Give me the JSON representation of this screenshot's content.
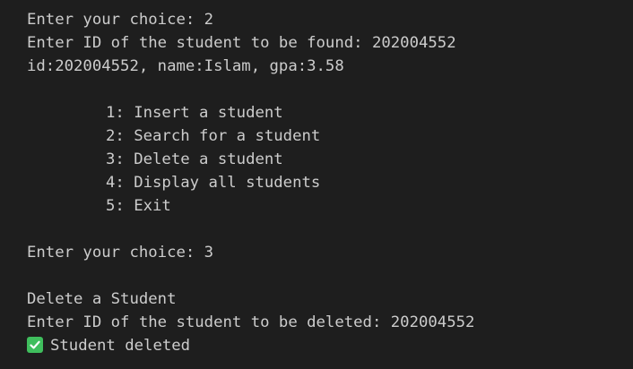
{
  "terminal": {
    "lines_before_menu": [
      "Enter your choice: 2",
      "Enter ID of the student to be found: 202004552",
      "id:202004552, name:Islam, gpa:3.58"
    ],
    "menu": [
      "1: Insert a student",
      "2: Search for a student",
      "3: Delete a student",
      "4: Display all students",
      "5: Exit"
    ],
    "prompt_choice": "Enter your choice: 3",
    "delete_header": "Delete a Student",
    "delete_prompt": "Enter ID of the student to be deleted: 202004552",
    "deleted_message": "Student deleted",
    "success_icon": "check-mark-icon",
    "success_color": "#3fbe5d"
  }
}
